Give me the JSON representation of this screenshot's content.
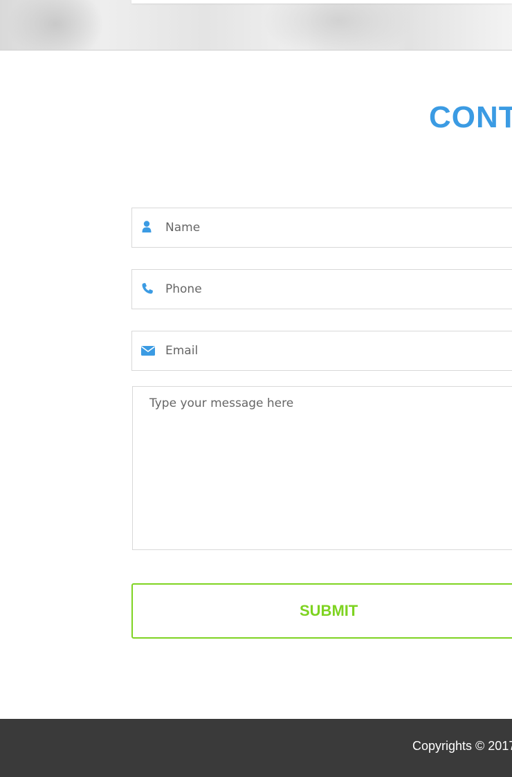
{
  "section": {
    "title": "CONT"
  },
  "form": {
    "name": {
      "placeholder": "Name",
      "icon": "user-icon"
    },
    "phone": {
      "placeholder": "Phone",
      "icon": "phone-icon"
    },
    "email": {
      "placeholder": "Email",
      "icon": "envelope-icon"
    },
    "message": {
      "placeholder": "Type your message here"
    },
    "submit_label": "SUBMIT"
  },
  "footer": {
    "copyright": "Copyrights © 2017"
  },
  "colors": {
    "accent_blue": "#3b9be3",
    "accent_green": "#7ed321",
    "footer_bg": "#3a3a3a"
  }
}
